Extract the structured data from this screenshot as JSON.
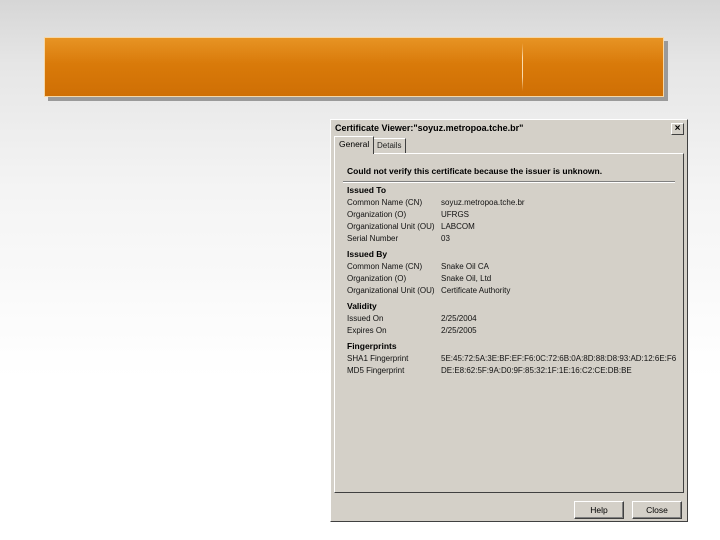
{
  "dialog": {
    "title": "Certificate Viewer:\"soyuz.metropoa.tche.br\"",
    "close_glyph": "×",
    "tabs": [
      {
        "label": "General"
      },
      {
        "label": "Details"
      }
    ],
    "warning": "Could not verify this certificate because the issuer is unknown.",
    "sections": [
      {
        "title": "Issued To",
        "fields": [
          {
            "label": "Common Name (CN)",
            "value": "soyuz.metropoa.tche.br"
          },
          {
            "label": "Organization (O)",
            "value": "UFRGS"
          },
          {
            "label": "Organizational Unit (OU)",
            "value": "LABCOM"
          },
          {
            "label": "Serial Number",
            "value": "03"
          }
        ]
      },
      {
        "title": "Issued By",
        "fields": [
          {
            "label": "Common Name (CN)",
            "value": "Snake Oil CA"
          },
          {
            "label": "Organization (O)",
            "value": "Snake Oil, Ltd"
          },
          {
            "label": "Organizational Unit (OU)",
            "value": "Certificate Authority"
          }
        ]
      },
      {
        "title": "Validity",
        "fields": [
          {
            "label": "Issued On",
            "value": "2/25/2004"
          },
          {
            "label": "Expires On",
            "value": "2/25/2005"
          }
        ]
      },
      {
        "title": "Fingerprints",
        "fields": [
          {
            "label": "SHA1 Fingerprint",
            "value": "5E:45:72:5A:3E:BF:EF:F6:0C:72:6B:0A:8D:88:D8:93:AD:12:6E:F6"
          },
          {
            "label": "MD5 Fingerprint",
            "value": "DE:E8:62:5F:9A:D0:9F:85:32:1F:1E:16:C2:CE:DB:BE"
          }
        ]
      }
    ],
    "buttons": {
      "help": "Help",
      "close": "Close"
    }
  }
}
